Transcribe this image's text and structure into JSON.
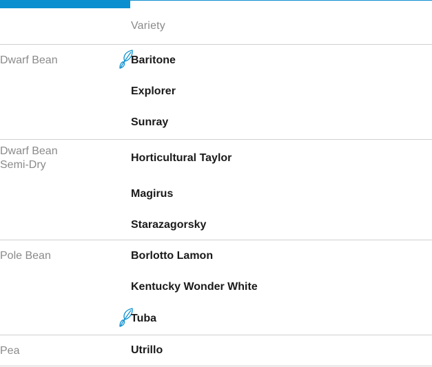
{
  "header": {
    "variety_label": "Variety"
  },
  "groups": [
    {
      "type": "Dwarf Bean",
      "varieties": [
        {
          "name": "Baritone",
          "icon": "leaf-icon"
        },
        {
          "name": "Explorer",
          "icon": ""
        },
        {
          "name": "Sunray",
          "icon": ""
        }
      ]
    },
    {
      "type": "Dwarf Bean\nSemi-Dry",
      "varieties": [
        {
          "name": "Horticultural Taylor",
          "icon": ""
        },
        {
          "name": "Magirus",
          "icon": ""
        },
        {
          "name": "Starazagorsky",
          "icon": ""
        }
      ]
    },
    {
      "type": "Pole Bean",
      "varieties": [
        {
          "name": "Borlotto Lamon",
          "icon": ""
        },
        {
          "name": "Kentucky Wonder White",
          "icon": ""
        },
        {
          "name": "Tuba",
          "icon": "leaf-icon"
        }
      ]
    },
    {
      "type": "Pea",
      "varieties": [
        {
          "name": "Utrillo",
          "icon": ""
        }
      ]
    }
  ],
  "colors": {
    "accent": "#0b8fcf",
    "muted_text": "#8a8a8a",
    "strong_text": "#1a1a1a",
    "divider": "#cfcfcf"
  }
}
